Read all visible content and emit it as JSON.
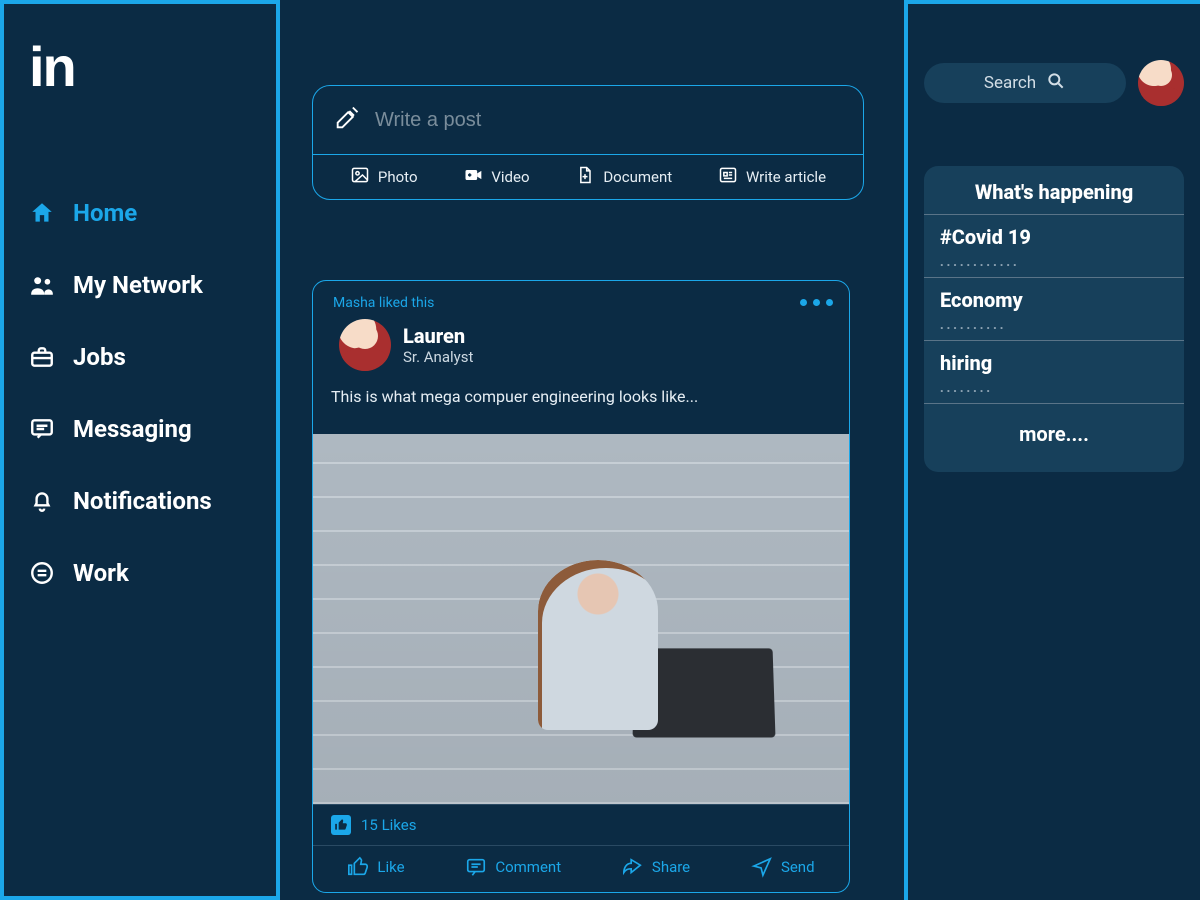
{
  "sidebar": {
    "items": [
      {
        "label": "Home",
        "active": true
      },
      {
        "label": "My Network"
      },
      {
        "label": "Jobs"
      },
      {
        "label": "Messaging"
      },
      {
        "label": "Notifications"
      },
      {
        "label": "Work"
      }
    ]
  },
  "compose": {
    "placeholder": "Write a post",
    "actions": {
      "photo": "Photo",
      "video": "Video",
      "document": "Document",
      "article": "Write article"
    }
  },
  "post": {
    "liked_by": "Masha liked this",
    "author_name": "Lauren",
    "author_title": "Sr. Analyst",
    "text": "This is what mega compuer engineering looks like...",
    "likes_text": "15 Likes",
    "actions": {
      "like": "Like",
      "comment": "Comment",
      "share": "Share",
      "send": "Send"
    }
  },
  "right": {
    "search_label": "Search",
    "panel_title": "What's happening",
    "trends": [
      {
        "name": "#Covid 19",
        "sub": "............"
      },
      {
        "name": "Economy",
        "sub": ".........."
      },
      {
        "name": "hiring",
        "sub": "........"
      }
    ],
    "more": "more...."
  }
}
